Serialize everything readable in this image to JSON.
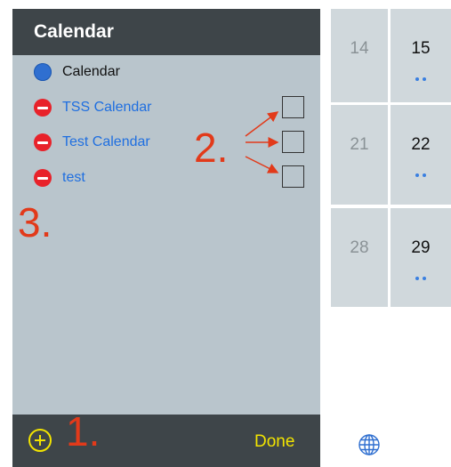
{
  "panel": {
    "title": "Calendar",
    "calendars": [
      {
        "label": "Calendar",
        "icon": "blue-circle-icon"
      },
      {
        "label": "TSS Calendar",
        "icon": "delete-icon"
      },
      {
        "label": "Test Calendar",
        "icon": "delete-icon"
      },
      {
        "label": "test",
        "icon": "delete-icon"
      }
    ]
  },
  "annotations": {
    "one": "1.",
    "two": "2.",
    "three": "3."
  },
  "toolbar": {
    "add_icon": "add-circle-icon",
    "done_label": "Done"
  },
  "calendar_grid": {
    "weeks": [
      {
        "left": "14",
        "right": "15"
      },
      {
        "left": "21",
        "right": "22"
      },
      {
        "left": "28",
        "right": "29"
      }
    ]
  },
  "colors": {
    "accent": "#f2e400",
    "link": "#1f6fe0",
    "delete": "#e8222a",
    "annotation": "#e23a1a",
    "panel": "#b9c5cc",
    "header": "#3e4549"
  }
}
